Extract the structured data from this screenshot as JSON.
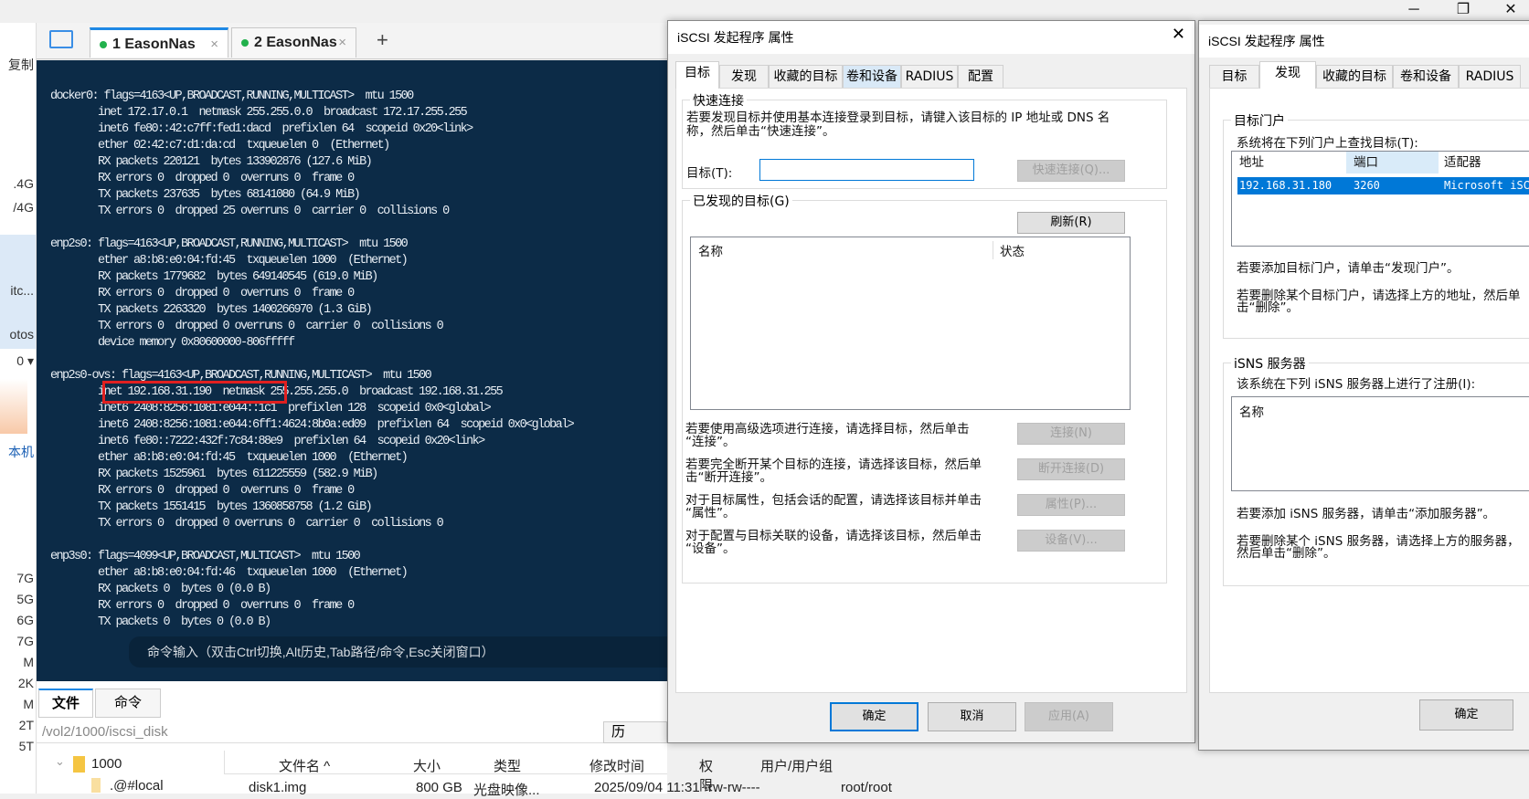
{
  "window": {
    "minimize": "─",
    "maximize": "❐",
    "close": "✕"
  },
  "left_strip": [
    "复制",
    ".4G",
    "/4G",
    "itc...",
    "otos",
    "0 ▾",
    "本机",
    "7G",
    "5G",
    "6G",
    "7G",
    "M",
    "2K",
    "M",
    "2T",
    "5T"
  ],
  "session_tabs": [
    {
      "label": "1 EasonNas",
      "close": "×"
    },
    {
      "label": "2 EasonNas",
      "close": "×"
    }
  ],
  "new_tab": "+",
  "terminal": {
    "lines": [
      "docker0: flags=4163<UP,BROADCAST,RUNNING,MULTICAST>  mtu 1500",
      "        inet 172.17.0.1  netmask 255.255.0.0  broadcast 172.17.255.255",
      "        inet6 fe80::42:c7ff:fed1:dacd  prefixlen 64  scopeid 0x20<link>",
      "        ether 02:42:c7:d1:da:cd  txqueuelen 0  (Ethernet)",
      "        RX packets 220121  bytes 133902876 (127.6 MiB)",
      "        RX errors 0  dropped 0  overruns 0  frame 0",
      "        TX packets 237635  bytes 68141080 (64.9 MiB)",
      "        TX errors 0  dropped 25 overruns 0  carrier 0  collisions 0",
      "",
      "enp2s0: flags=4163<UP,BROADCAST,RUNNING,MULTICAST>  mtu 1500",
      "        ether a8:b8:e0:04:fd:45  txqueuelen 1000  (Ethernet)",
      "        RX packets 1779682  bytes 649140545 (619.0 MiB)",
      "        RX errors 0  dropped 0  overruns 0  frame 0",
      "        TX packets 2263320  bytes 1400266970 (1.3 GiB)",
      "        TX errors 0  dropped 0 overruns 0  carrier 0  collisions 0",
      "        device memory 0x80600000-806fffff",
      "",
      "enp2s0-ovs: flags=4163<UP,BROADCAST,RUNNING,MULTICAST>  mtu 1500",
      "        inet 192.168.31.190  netmask 255.255.255.0  broadcast 192.168.31.255",
      "        inet6 2408:8256:1081:e044::1c1  prefixlen 128  scopeid 0x0<global>",
      "        inet6 2408:8256:1081:e044:6ff1:4624:8b0a:ed09  prefixlen 64  scopeid 0x0<global>",
      "        inet6 fe80::7222:432f:7c84:88e9  prefixlen 64  scopeid 0x20<link>",
      "        ether a8:b8:e0:04:fd:45  txqueuelen 1000  (Ethernet)",
      "        RX packets 1525961  bytes 611225559 (582.9 MiB)",
      "        RX errors 0  dropped 0  overruns 0  frame 0",
      "        TX packets 1551415  bytes 1360858758 (1.2 GiB)",
      "        TX errors 0  dropped 0 overruns 0  carrier 0  collisions 0",
      "",
      "enp3s0: flags=4099<UP,BROADCAST,MULTICAST>  mtu 1500",
      "        ether a8:b8:e0:04:fd:46  txqueuelen 1000  (Ethernet)",
      "        RX packets 0  bytes 0 (0.0 B)",
      "        RX errors 0  dropped 0  overruns 0  frame 0",
      "        TX packets 0  bytes 0 (0.0 B)"
    ],
    "command_hint": "命令输入（双击Ctrl切换,Alt历史,Tab路径/命令,Esc关闭窗口）"
  },
  "bottom": {
    "tabs": [
      "文件",
      "命令"
    ],
    "path": "/vol2/1000/iscsi_disk",
    "history_btn": "历",
    "tree": [
      "1000",
      ".@#local"
    ],
    "columns": [
      "文件名 ^",
      "大小",
      "类型",
      "修改时间",
      "权限",
      "用户/用户组"
    ],
    "rows": [
      [
        "disk1.img",
        "800 GB",
        "光盘映像...",
        "2025/09/04 11:31",
        "-rw-rw----",
        "root/root"
      ]
    ]
  },
  "dialog1": {
    "title": "iSCSI 发起程序 属性",
    "close": "✕",
    "tabs": [
      "目标",
      "发现",
      "收藏的目标",
      "卷和设备",
      "RADIUS",
      "配置"
    ],
    "quick": {
      "group": "快速连接",
      "desc1": "若要发现目标并使用基本连接登录到目标，请键入该目标的 IP 地址或 DNS 名",
      "desc2": "称，然后单击“快速连接”。",
      "target_label": "目标(T):",
      "target_value": "",
      "quick_btn": "快速连接(Q)..."
    },
    "discovered": {
      "group": "已发现的目标(G)",
      "refresh": "刷新(R)",
      "col_name": "名称",
      "col_status": "状态",
      "actions": [
        {
          "l1": "若要使用高级选项进行连接，请选择目标，然后单击",
          "l2": "“连接”。",
          "btn": "连接(N)"
        },
        {
          "l1": "若要完全断开某个目标的连接，请选择该目标，然后单",
          "l2": "击“断开连接”。",
          "btn": "断开连接(D)"
        },
        {
          "l1": "对于目标属性，包括会话的配置，请选择该目标并单击",
          "l2": "“属性”。",
          "btn": "属性(P)..."
        },
        {
          "l1": "对于配置与目标关联的设备，请选择该目标，然后单击",
          "l2": "“设备”。",
          "btn": "设备(V)..."
        }
      ]
    },
    "ok": "确定",
    "cancel": "取消",
    "apply": "应用(A)"
  },
  "dialog2": {
    "title": "iSCSI 发起程序 属性",
    "tabs": [
      "目标",
      "发现",
      "收藏的目标",
      "卷和设备",
      "RADIUS"
    ],
    "portal": {
      "group": "目标门户",
      "label": "系统将在下列门户上查找目标(T):",
      "columns": [
        "地址",
        "端口",
        "适配器"
      ],
      "row": [
        "192.168.31.180",
        "3260",
        "Microsoft iSCSI Initiator"
      ],
      "add_hint": "若要添加目标门户，请单击“发现门户”。",
      "del_hint1": "若要删除某个目标门户，请选择上方的地址，然后单",
      "del_hint2": "击“删除”。"
    },
    "isns": {
      "group": "iSNS 服务器",
      "label": "该系统在下列 iSNS 服务器上进行了注册(I):",
      "col_name": "名称",
      "add_hint": "若要添加 iSNS 服务器，请单击“添加服务器”。",
      "del_hint1": "若要删除某个 iSNS 服务器，请选择上方的服务器，",
      "del_hint2": "然后单击“删除”。"
    },
    "ok": "确定"
  },
  "colors": {
    "terminal_bg": "#0c2b47",
    "highlight": "#e02020",
    "selection": "#0078d7",
    "accent": "#1e88e5"
  }
}
